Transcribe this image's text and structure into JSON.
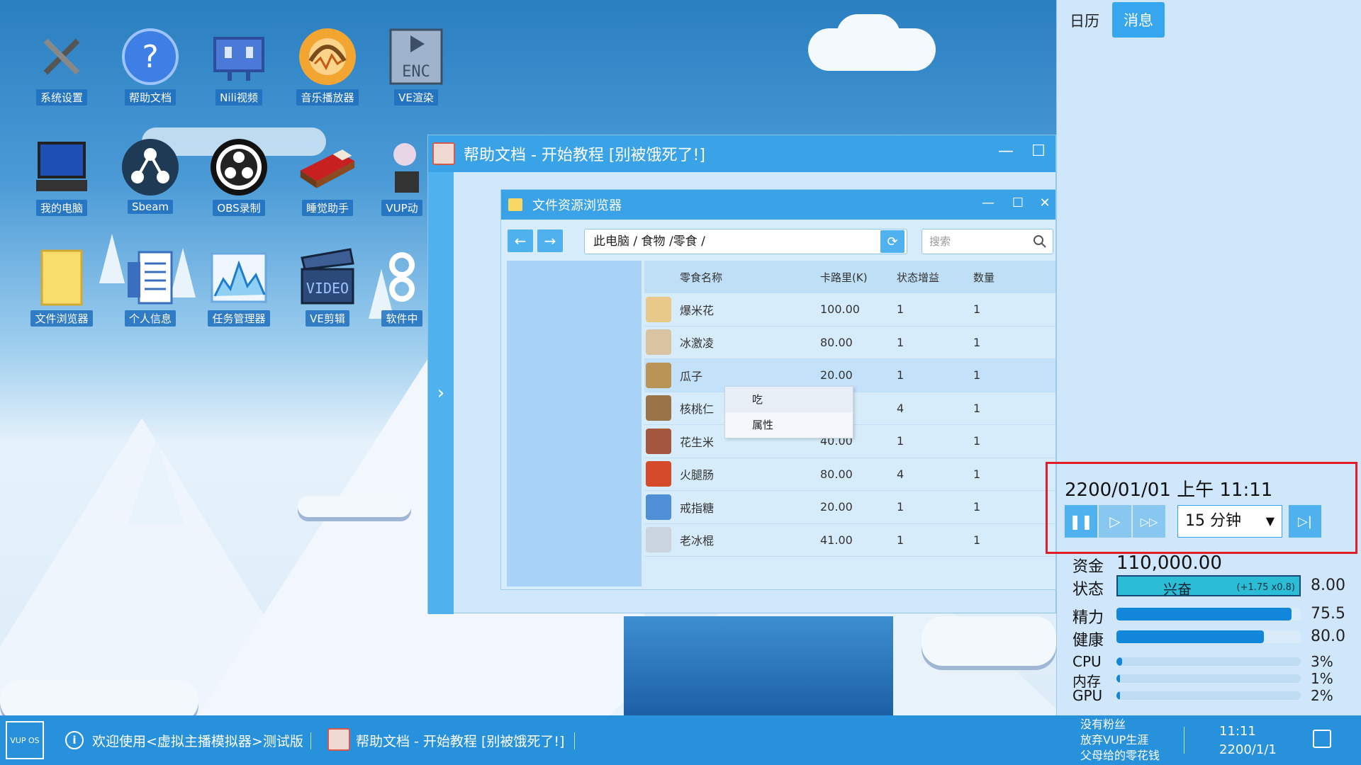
{
  "desktop": {
    "icons": [
      {
        "label": "系统设置",
        "icon": "wrench-screwdriver-icon"
      },
      {
        "label": "帮助文档",
        "icon": "question-icon"
      },
      {
        "label": "Nili视频",
        "icon": "video-tv-icon"
      },
      {
        "label": "音乐播放器",
        "icon": "headphones-icon"
      },
      {
        "label": "VE渲染",
        "icon": "render-encoder-icon"
      },
      {
        "label": "我的电脑",
        "icon": "computer-icon"
      },
      {
        "label": "Sbeam",
        "icon": "sbeam-icon"
      },
      {
        "label": "OBS录制",
        "icon": "obs-icon"
      },
      {
        "label": "睡觉助手",
        "icon": "bed-icon"
      },
      {
        "label": "VUP动",
        "icon": "vup-icon"
      },
      {
        "label": "文件浏览器",
        "icon": "folder-icon"
      },
      {
        "label": "个人信息",
        "icon": "profile-doc-icon"
      },
      {
        "label": "任务管理器",
        "icon": "task-chart-icon"
      },
      {
        "label": "VE剪辑",
        "icon": "clapper-icon"
      },
      {
        "label": "软件中",
        "icon": "store-icon"
      }
    ]
  },
  "help_window": {
    "title": "帮助文档 - 开始教程 [别被饿死了!]",
    "minimize": "—",
    "maximize": "☐",
    "side_arrow": "›"
  },
  "explorer": {
    "title": "文件资源浏览器",
    "minimize": "—",
    "maximize": "☐",
    "close": "✕",
    "back": "←",
    "forward": "→",
    "address": "此电脑 /   食物 /零食 /",
    "refresh": "⟳",
    "search_placeholder": "搜索",
    "columns": [
      "零食名称",
      "卡路里(K)",
      "状态增益",
      "数量"
    ],
    "rows": [
      {
        "name": "爆米花",
        "calories": "100.00",
        "buff": "1",
        "qty": "1",
        "color": "#e8c98a"
      },
      {
        "name": "冰激凌",
        "calories": "80.00",
        "buff": "1",
        "qty": "1",
        "color": "#d9c3a1"
      },
      {
        "name": "瓜子",
        "calories": "20.00",
        "buff": "1",
        "qty": "1",
        "color": "#b99456"
      },
      {
        "name": "核桃仁",
        "calories": "",
        "buff": "4",
        "qty": "1",
        "color": "#9a7448"
      },
      {
        "name": "花生米",
        "calories": "40.00",
        "buff": "1",
        "qty": "1",
        "color": "#a4573d"
      },
      {
        "name": "火腿肠",
        "calories": "80.00",
        "buff": "4",
        "qty": "1",
        "color": "#d44a2a"
      },
      {
        "name": "戒指糖",
        "calories": "20.00",
        "buff": "1",
        "qty": "1",
        "color": "#4f8fd8"
      },
      {
        "name": "老冰棍",
        "calories": "41.00",
        "buff": "1",
        "qty": "1",
        "color": "#c9d4de"
      }
    ],
    "selected_row": 2
  },
  "context_menu": {
    "items": [
      "吃",
      "属性"
    ]
  },
  "right_panel": {
    "tab_calendar": "日历",
    "tab_messages": "消息",
    "clock": "2200/01/01 上午 11:11",
    "pause": "❚❚",
    "play": "▷",
    "fast_forward": "▷▷",
    "speed": "15 分钟",
    "speed_arrow": "▼",
    "skip": "▷|",
    "stats": {
      "money_label": "资金",
      "money_value": "110,000.00",
      "mood_label": "状态",
      "mood_text": "兴奋",
      "mood_delta": "(+1.75 x0.8)",
      "mood_value": "8.00",
      "energy_label": "精力",
      "energy_value": "75.5",
      "energy_fill": 0.95,
      "health_label": "健康",
      "health_value": "80.0",
      "health_fill": 0.8,
      "cpu_label": "CPU",
      "cpu_value": "3%",
      "cpu_fill": 0.03,
      "mem_label": "内存",
      "mem_value": "1%",
      "mem_fill": 0.01,
      "gpu_label": "GPU",
      "gpu_value": "2%",
      "gpu_fill": 0.02
    }
  },
  "taskbar": {
    "logo_text": "VUP OS",
    "info_glyph": "i",
    "welcome": "欢迎使用<虚拟主播模拟器>测试版",
    "task_title": "帮助文档 - 开始教程 [别被饿死了!]",
    "fans_lines": [
      "没有粉丝",
      "放弃VUP生涯",
      "父母给的零花钱"
    ],
    "time": "11:11",
    "date": "2200/1/1"
  }
}
